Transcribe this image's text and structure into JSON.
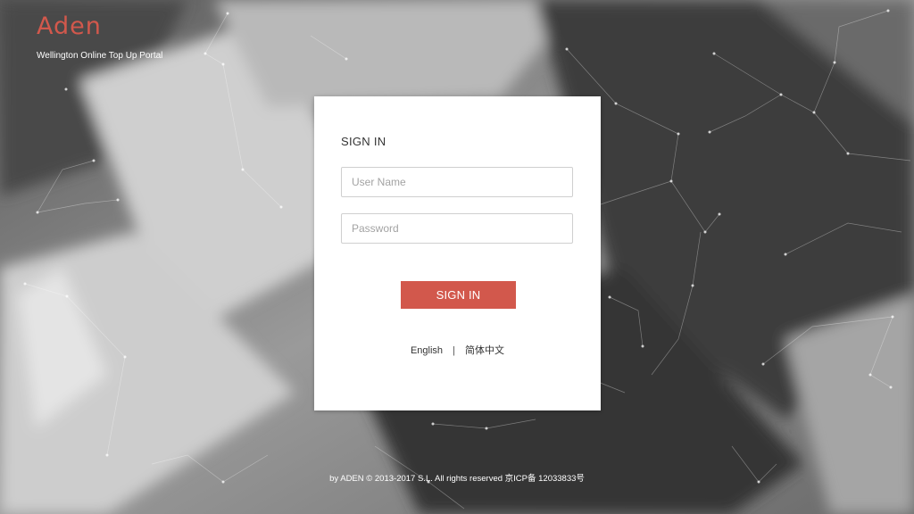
{
  "brand": {
    "logo": "Aden",
    "subtitle": "Wellington Online Top Up Portal"
  },
  "login": {
    "title": "SIGN IN",
    "username_placeholder": "User Name",
    "password_placeholder": "Password",
    "submit_label": "SIGN IN"
  },
  "languages": {
    "english": "English",
    "separator": "|",
    "chinese": "简体中文"
  },
  "footer": {
    "text": "by ADEN © 2013-2017 S.L. All rights reserved 京ICP备 12033833号"
  },
  "colors": {
    "accent": "#d2584c",
    "card": "#ffffff"
  }
}
